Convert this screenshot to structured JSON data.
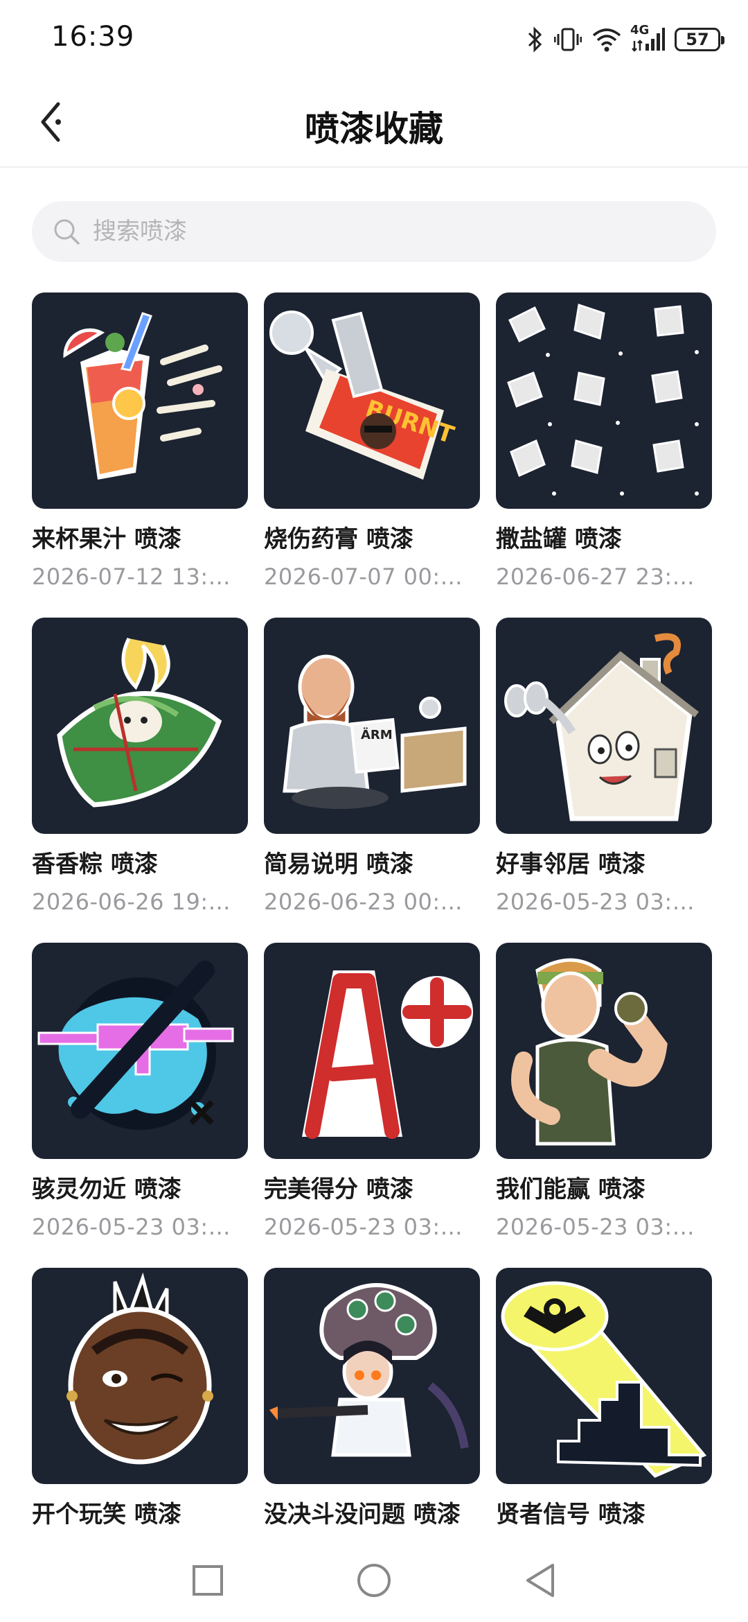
{
  "status_bar": {
    "time": "16:39",
    "battery": "57",
    "network": "4G",
    "icons": [
      "bluetooth-icon",
      "vibrate-icon",
      "wifi-icon",
      "signal-icon",
      "battery-icon"
    ]
  },
  "header": {
    "title": "喷漆收藏",
    "back_icon": "chevron-left-icon"
  },
  "search": {
    "placeholder": "搜索喷漆",
    "value": "",
    "icon": "search-icon"
  },
  "colors": {
    "tile_background": "#1c2331",
    "title_text": "#1a1a1a",
    "date_text": "#9a9a9e",
    "search_background": "#f3f3f5"
  },
  "sprays": [
    {
      "title": "来杯果汁 喷漆",
      "date": "2026-07-12 13:…",
      "icon": "juice-cup-icon"
    },
    {
      "title": "烧伤药膏 喷漆",
      "date": "2026-07-07 00:…",
      "icon": "burn-ointment-icon"
    },
    {
      "title": "撒盐罐 喷漆",
      "date": "2026-06-27 23:…",
      "icon": "salt-shaker-pattern-icon"
    },
    {
      "title": "香香粽 喷漆",
      "date": "2026-06-26 19:…",
      "icon": "zongzi-icon"
    },
    {
      "title": "简易说明 喷漆",
      "date": "2026-06-23 00:…",
      "icon": "mechanic-manual-icon"
    },
    {
      "title": "好事邻居 喷漆",
      "date": "2026-05-23 03:…",
      "icon": "house-binoculars-icon"
    },
    {
      "title": "骇灵勿近 喷漆",
      "date": "2026-05-23 03:…",
      "icon": "crossed-rifle-icon"
    },
    {
      "title": "完美得分 喷漆",
      "date": "2026-05-23 03:…",
      "icon": "a-plus-grade-icon"
    },
    {
      "title": "我们能赢 喷漆",
      "date": "2026-05-23 03:…",
      "icon": "flexing-woman-icon"
    },
    {
      "title": "开个玩笑 喷漆",
      "date": "",
      "icon": "winking-face-icon"
    },
    {
      "title": "没决斗没问题 喷漆",
      "date": "",
      "icon": "girl-with-rifle-icon"
    },
    {
      "title": "贤者信号 喷漆",
      "date": "",
      "icon": "sage-signal-icon"
    }
  ],
  "nav_bar": {
    "icons": [
      "recents-square-icon",
      "home-circle-icon",
      "back-triangle-icon"
    ]
  }
}
